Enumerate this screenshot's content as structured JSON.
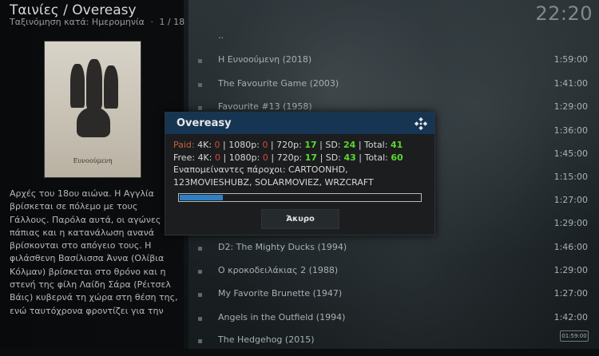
{
  "header": {
    "title": "Ταινίες / Overeasy",
    "sort_label": "Ταξινόμηση κατά: Ημερομηνία",
    "separator": "·",
    "page_count": "1 / 18",
    "clock": "22:20"
  },
  "poster": {
    "title": "Ευνοούμενη"
  },
  "plot": "Αρχές του 18ου αιώνα. Η Αγγλία βρίσκεται σε πόλεμο με τους Γάλλους. Παρόλα αυτά, οι αγώνες πάπιας και η κατανάλωση ανανά βρίσκονται στο απόγειο τους. Η φιλάσθενη Βασίλισσα Άννα (Ολίβια Κόλμαν) βρίσκεται στο θρόνο και η στενή της φίλη Λαίδη Σάρα (Ρέιτσελ Βάις) κυβερνά τη χώρα στη θέση της, ενώ ταυτόχρονα φροντίζει για την υγεία της Άννας και το",
  "list": {
    "parent": "..",
    "items": [
      {
        "name": "Η Ευνοούμενη (2018)",
        "duration": "1:59:00"
      },
      {
        "name": "The Favourite Game (2003)",
        "duration": "1:41:00"
      },
      {
        "name": "Favourite #13 (1958)",
        "duration": "1:29:00"
      },
      {
        "name": "",
        "duration": "1:36:00"
      },
      {
        "name": "",
        "duration": "1:45:00"
      },
      {
        "name": "",
        "duration": "1:15:00"
      },
      {
        "name": "",
        "duration": "1:27:00"
      },
      {
        "name": "",
        "duration": "1:29:00"
      },
      {
        "name": "D2: The Mighty Ducks (1994)",
        "duration": "1:46:00"
      },
      {
        "name": "Ο κροκοδειλάκιας 2 (1988)",
        "duration": "1:29:00"
      },
      {
        "name": "My Favorite Brunette (1947)",
        "duration": "1:27:00"
      },
      {
        "name": "Angels in the Outfield (1994)",
        "duration": "1:42:00"
      },
      {
        "name": "The Hedgehog (2015)",
        "duration": ""
      }
    ]
  },
  "dialog": {
    "title": "Overeasy",
    "paid": {
      "label": "Paid:",
      "k4_label": "4K:",
      "k4": "0",
      "p1080_label": "1080p:",
      "p1080": "0",
      "p720_label": "720p:",
      "p720": "17",
      "sd_label": "SD:",
      "sd": "24",
      "total_label": "Total:",
      "total": "41"
    },
    "free": {
      "label": "Free:",
      "k4_label": "4K:",
      "k4": "0",
      "p1080_label": "1080p:",
      "p1080": "0",
      "p720_label": "720p:",
      "p720": "17",
      "sd_label": "SD:",
      "sd": "43",
      "total_label": "Total:",
      "total": "60"
    },
    "pending_label": "Εναπομείναντες πάροχοι:",
    "pending_providers": "CARTOONHD, 123MOVIESHUBZ, SOLARMOVIEZ, WRZCRAFT",
    "progress_fraction": 0.18,
    "cancel_label": "Άκυρο"
  },
  "footer": {
    "mini_clock": "01:59:00"
  },
  "icons": {
    "kodi": "kodi-logo-icon",
    "bullet": "list-bullet-icon"
  },
  "colors": {
    "accent": "#2f7fc4",
    "header_bar": "#163552",
    "green": "#5cd82c",
    "red": "#d8483a",
    "paid": "#c8613e"
  }
}
